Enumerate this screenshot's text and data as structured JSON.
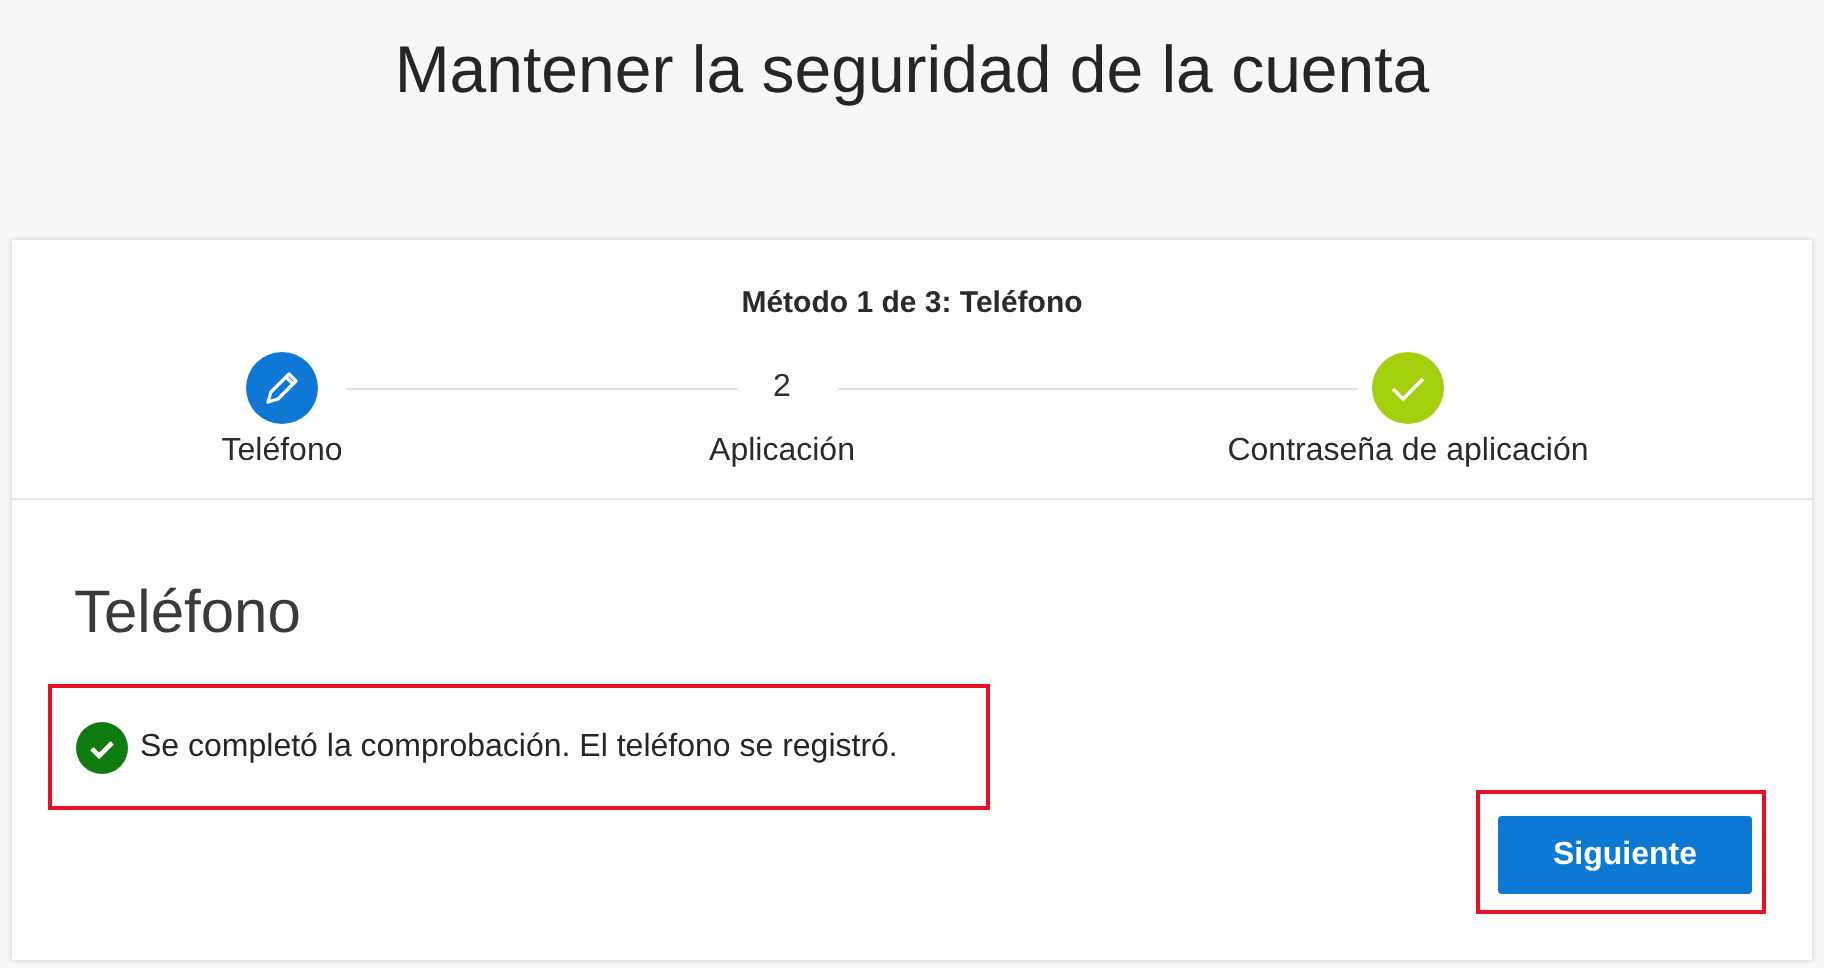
{
  "page": {
    "title": "Mantener la seguridad de la cuenta"
  },
  "progress": {
    "heading": "Método 1 de 3: Teléfono",
    "steps": [
      {
        "label": "Teléfono",
        "kind": "current"
      },
      {
        "label": "Aplicación",
        "kind": "pending",
        "number": "2"
      },
      {
        "label": "Contraseña de aplicación",
        "kind": "done"
      }
    ]
  },
  "section": {
    "title": "Teléfono",
    "message": {
      "text": "Se completó la comprobación. El teléfono se registró.",
      "kind": "success",
      "highlighted": true
    }
  },
  "next_button": {
    "label": "Siguiente",
    "highlighted": true
  }
}
